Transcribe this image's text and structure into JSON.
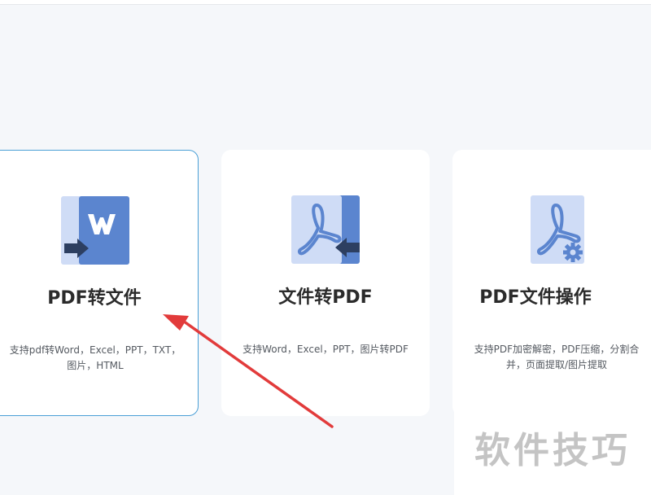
{
  "cards": [
    {
      "title": "PDF转文件",
      "desc_line1": "支持pdf转Word，Excel，PPT，TXT，",
      "desc_line2": "图片，HTML",
      "icon": "word-convert-icon",
      "selected": true
    },
    {
      "title": "文件转PDF",
      "desc_line1": "支持Word，Excel，PPT，图片转PDF",
      "icon": "pdf-convert-icon",
      "selected": false
    },
    {
      "title": "PDF文件操作",
      "desc_line1": "支持PDF加密解密，PDF压缩，分割合",
      "desc_line2": "并，页面提取/图片提取",
      "icon": "pdf-settings-icon",
      "selected": false
    }
  ],
  "watermark": "软件技巧",
  "colors": {
    "icon_dark": "#5b85cf",
    "icon_light": "#cfdcf6",
    "arrow_navy": "#2d3f61",
    "annotation": "#e23b3b",
    "selected_border": "#4a9fd6"
  }
}
